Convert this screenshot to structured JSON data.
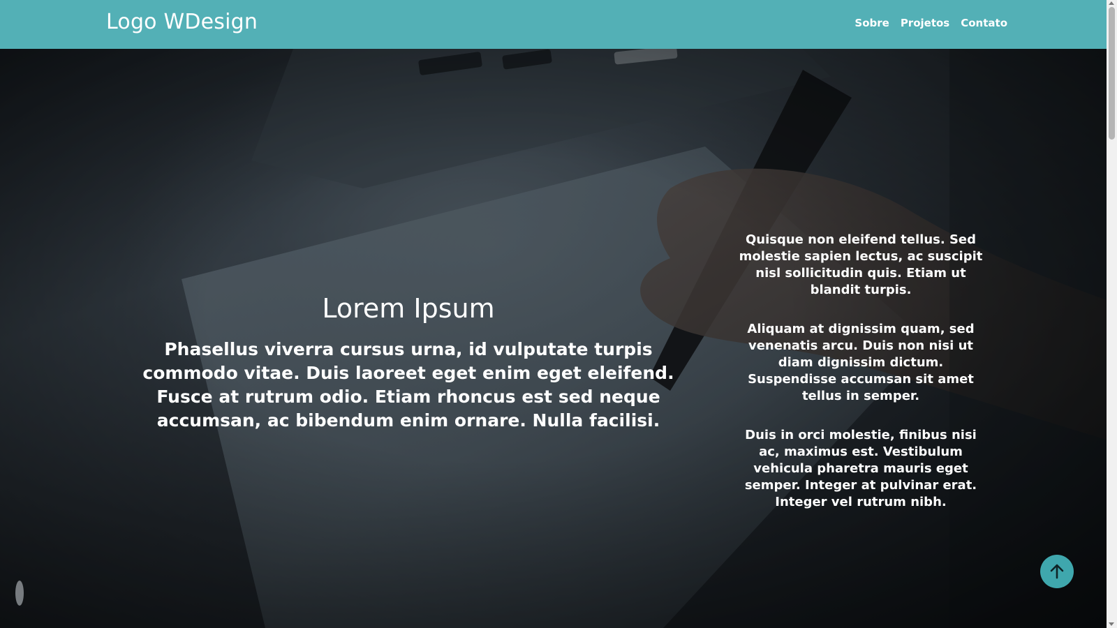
{
  "header": {
    "logo": "Logo WDesign",
    "nav": [
      {
        "label": "Sobre"
      },
      {
        "label": "Projetos"
      },
      {
        "label": "Contato"
      }
    ]
  },
  "hero": {
    "title": "Lorem Ipsum",
    "text": "Phasellus viverra cursus urna, id vulputate turpis commodo vitae. Duis laoreet eget enim eget eleifend. Fusce at rutrum odio. Etiam rhoncus est sed neque accumsan, ac bibendum enim ornare. Nulla facilisi.",
    "side_paragraphs": [
      "Quisque non eleifend tellus. Sed molestie sapien lectus, ac suscipit nisl sollicitudin quis. Etiam ut blandit turpis.",
      "Aliquam at dignissim quam, sed venenatis arcu. Duis non nisi ut diam dignissim dictum. Suspendisse accumsan sit amet tellus in semper.",
      "Duis in orci molestie, finibus nisi ac, maximus est. Vestibulum vehicula pharetra mauris eget semper. Integer at pulvinar erat. Integer vel rutrum nibh."
    ]
  },
  "back_to_top": {
    "icon": "arrow-up-icon"
  },
  "colors": {
    "navbar": "#53b0b6",
    "button": "#3fa7ad",
    "text": "#ffffff"
  }
}
